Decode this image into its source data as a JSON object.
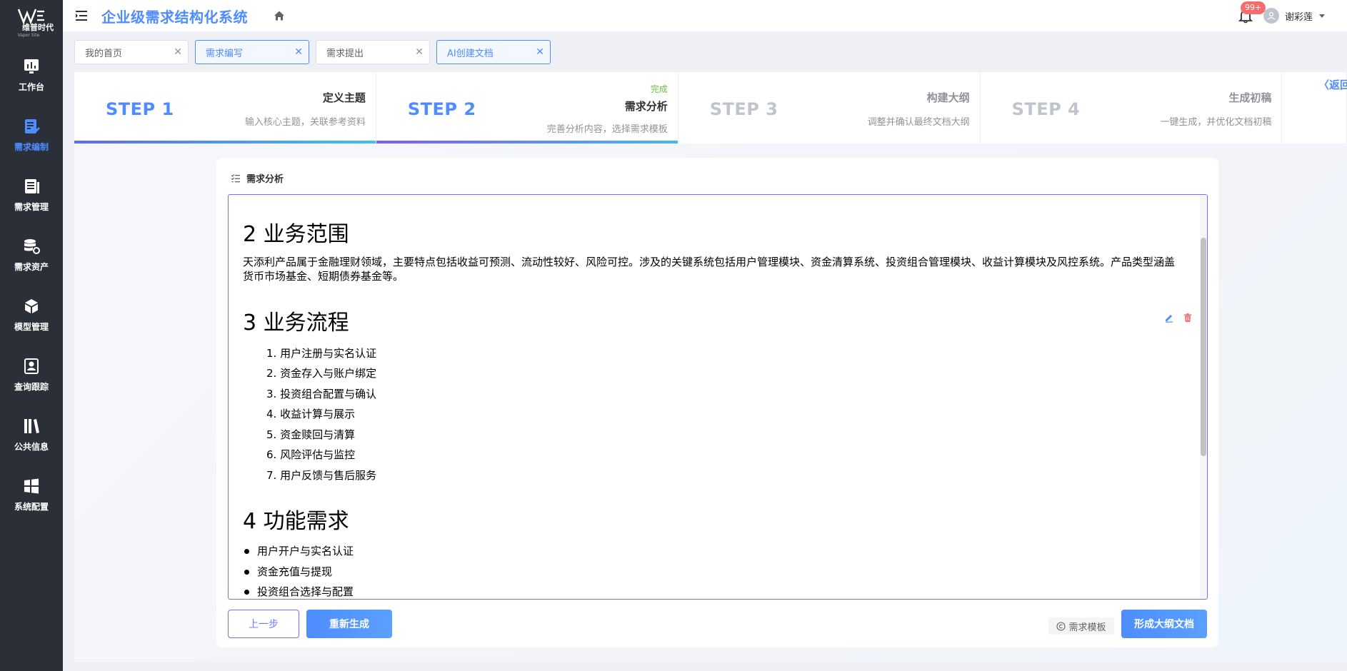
{
  "app": {
    "logo_text": "维普时代",
    "logo_sub": "Vapor Site",
    "title": "企业级需求结构化系统"
  },
  "sidebar": {
    "items": [
      {
        "label": "工作台",
        "icon": "dashboard-icon"
      },
      {
        "label": "需求编制",
        "icon": "edit-document-icon",
        "active": true
      },
      {
        "label": "需求管理",
        "icon": "document-list-icon"
      },
      {
        "label": "需求资产",
        "icon": "database-icon"
      },
      {
        "label": "模型管理",
        "icon": "cube-icon"
      },
      {
        "label": "查询跟踪",
        "icon": "search-person-icon"
      },
      {
        "label": "公共信息",
        "icon": "books-icon"
      },
      {
        "label": "系统配置",
        "icon": "windows-icon"
      }
    ]
  },
  "header": {
    "notification_badge": "99+",
    "username": "谢彩莲"
  },
  "tabs": [
    {
      "label": "我的首页",
      "active": false
    },
    {
      "label": "需求编写",
      "active": true
    },
    {
      "label": "需求提出",
      "active": false
    },
    {
      "label": "AI创建文档",
      "active": true
    }
  ],
  "steps": [
    {
      "num": "STEP 1",
      "title": "定义主题",
      "desc": "输入核心主题，关联参考资料",
      "status": ""
    },
    {
      "num": "STEP 2",
      "title": "需求分析",
      "desc": "完善分析内容，选择需求模板",
      "status": "完成"
    },
    {
      "num": "STEP 3",
      "title": "构建大纲",
      "desc": "调整并确认最终文档大纲",
      "status": ""
    },
    {
      "num": "STEP 4",
      "title": "生成初稿",
      "desc": "一键生成，并优化文档初稿",
      "status": ""
    }
  ],
  "back_label": "返回",
  "card": {
    "title": "需求分析"
  },
  "document": {
    "section2": {
      "heading": "2 业务范围",
      "body": "天添利产品属于金融理财领域，主要特点包括收益可预测、流动性较好、风险可控。涉及的关键系统包括用户管理模块、资金清算系统、投资组合管理模块、收益计算模块及风控系统。产品类型涵盖货币市场基金、短期债券基金等。"
    },
    "section3": {
      "heading": "3 业务流程",
      "items": [
        "1. 用户注册与实名认证",
        "2. 资金存入与账户绑定",
        "3. 投资组合配置与确认",
        "4. 收益计算与展示",
        "5. 资金赎回与清算",
        "6. 风险评估与监控",
        "7. 用户反馈与售后服务"
      ]
    },
    "section4": {
      "heading": "4 功能需求",
      "items": [
        "用户开户与实名认证",
        "资金充值与提现",
        "投资组合选择与配置"
      ]
    }
  },
  "buttons": {
    "prev": "上一步",
    "regenerate": "重新生成",
    "template": "需求模板",
    "form_outline": "形成大纲文档"
  },
  "colors": {
    "primary": "#4f8cff",
    "sidebar_bg": "#2b3038",
    "success": "#67c23a",
    "danger": "#f56c6c",
    "editor_border": "#7b6cf0"
  }
}
